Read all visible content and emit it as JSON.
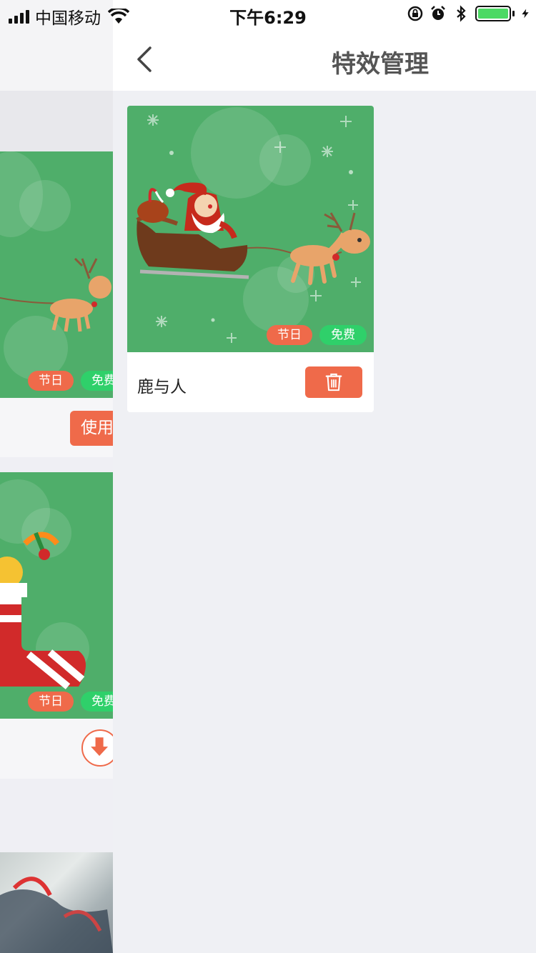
{
  "status_bar": {
    "carrier": "中国移动",
    "time": "下午6:29"
  },
  "background_page": {
    "cards": [
      {
        "tags": [
          "节日",
          "免费"
        ],
        "action_label": "使用"
      },
      {
        "tags": [
          "节日",
          "免费"
        ],
        "action": "download-icon"
      }
    ]
  },
  "panel": {
    "title": "特效管理",
    "back_icon": "chevron-left-icon",
    "effects": [
      {
        "name": "鹿与人",
        "tags": [
          "节日",
          "免费"
        ],
        "action": "trash-icon"
      }
    ]
  },
  "colors": {
    "accent": "#ef6a4a",
    "free_tag": "#2fd06a",
    "thumbnail_green": "#4fae6a",
    "battery": "#4cd964"
  }
}
